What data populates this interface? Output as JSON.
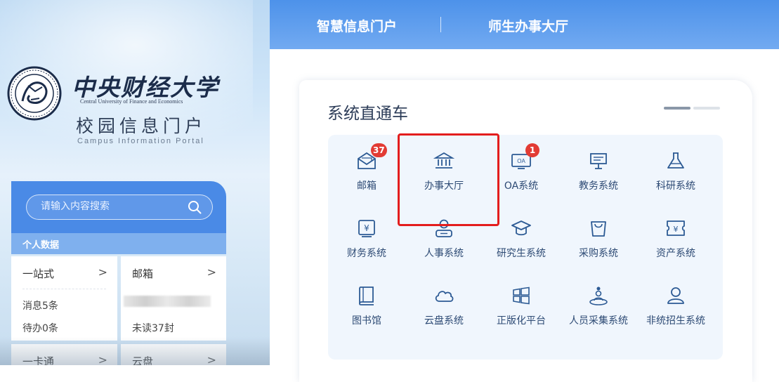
{
  "brand": {
    "university_cn": "中央财经大学",
    "university_en": "Central University of Finance and Economics",
    "portal_cn": "校园信息门户",
    "portal_en": "Campus Information Portal"
  },
  "search": {
    "placeholder": "请输入内容搜索"
  },
  "personal": {
    "section_label": "个人数据",
    "cards": [
      {
        "title": "一站式",
        "lines": [
          "消息5条",
          "待办0条"
        ]
      },
      {
        "title": "邮箱",
        "lines": [
          "",
          "未读37封"
        ]
      },
      {
        "title": "一卡通"
      },
      {
        "title": "云盘"
      }
    ],
    "chevron": ">"
  },
  "header": {
    "tabs": [
      {
        "label": "智慧信息门户"
      },
      {
        "label": "师生办事大厅"
      }
    ]
  },
  "systems": {
    "title": "系统直通车",
    "apps": [
      {
        "label": "邮箱",
        "icon": "mail-icon",
        "badge": "37"
      },
      {
        "label": "办事大厅",
        "icon": "hall-icon"
      },
      {
        "label": "OA系统",
        "icon": "oa-icon",
        "badge": "1",
        "icon_text": "OA"
      },
      {
        "label": "教务系统",
        "icon": "board-icon"
      },
      {
        "label": "科研系统",
        "icon": "flask-icon"
      },
      {
        "label": "财务系统",
        "icon": "finance-icon",
        "icon_text": "¥"
      },
      {
        "label": "人事系统",
        "icon": "person-icon"
      },
      {
        "label": "研究生系统",
        "icon": "graduation-cap-icon"
      },
      {
        "label": "采购系统",
        "icon": "bag-icon"
      },
      {
        "label": "资产系统",
        "icon": "asset-icon",
        "icon_text": "¥"
      },
      {
        "label": "图书馆",
        "icon": "book-icon"
      },
      {
        "label": "云盘系统",
        "icon": "cloud-icon"
      },
      {
        "label": "正版化平台",
        "icon": "windows-icon"
      },
      {
        "label": "人员采集系统",
        "icon": "collect-person-icon"
      },
      {
        "label": "非统招生系统",
        "icon": "user-icon"
      }
    ]
  },
  "colors": {
    "accent": "#4a8ae6",
    "icon": "#2c5a94",
    "badge": "#e23b34",
    "highlight": "#e31d1d"
  }
}
